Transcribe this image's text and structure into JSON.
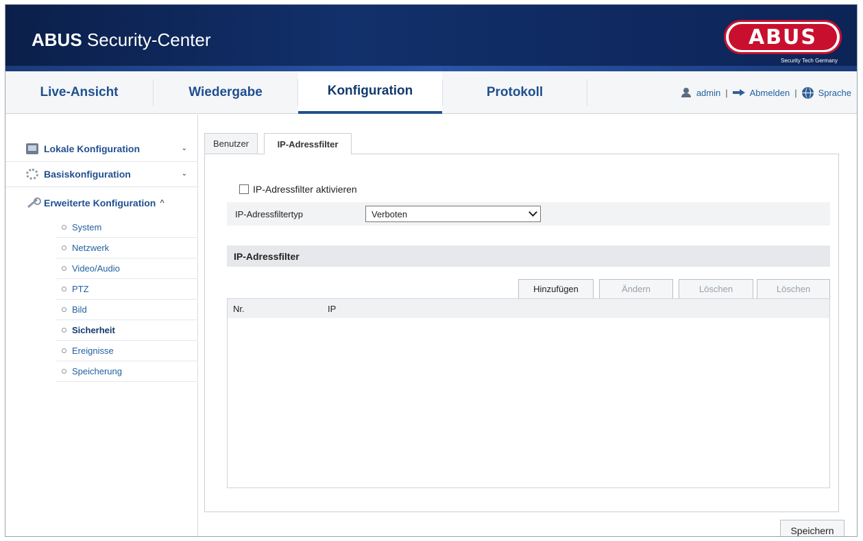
{
  "header": {
    "brand_bold": "ABUS",
    "brand_rest": " Security-Center",
    "logo_text": "ABUS",
    "logo_tagline": "Security Tech Germany"
  },
  "nav": {
    "tabs": [
      "Live-Ansicht",
      "Wiedergabe",
      "Konfiguration",
      "Protokoll"
    ],
    "active_tab": "Konfiguration",
    "user": "admin",
    "logout": "Abmelden",
    "language": "Sprache",
    "separator": "|"
  },
  "sidebar": {
    "groups": [
      {
        "label": "Lokale Konfiguration",
        "icon": "local-config-icon",
        "chevron": "⌄"
      },
      {
        "label": "Basiskonfiguration",
        "icon": "basic-config-icon",
        "chevron": "⌄"
      },
      {
        "label": "Erweiterte Konfiguration",
        "icon": "wrench-icon",
        "chevron": "^"
      }
    ],
    "items": [
      "System",
      "Netzwerk",
      "Video/Audio",
      "PTZ",
      "Bild",
      "Sicherheit",
      "Ereignisse",
      "Speicherung"
    ],
    "active_item": "Sicherheit"
  },
  "content": {
    "tabs": [
      "Benutzer",
      "IP-Adressfilter"
    ],
    "active_tab": "IP-Adressfilter",
    "enable_checkbox_label": "IP-Adressfilter aktivieren",
    "enable_checked": false,
    "filter_type_label": "IP-Adressfiltertyp",
    "filter_type_value": "Verboten",
    "section_title": "IP-Adressfilter",
    "buttons": {
      "add": "Hinzufügen",
      "edit": "Ändern",
      "delete": "Löschen",
      "delete_all": "Löschen"
    },
    "table": {
      "columns": [
        "Nr.",
        "IP"
      ],
      "rows": []
    },
    "save": "Speichern"
  },
  "colors": {
    "header_bg": "#0d2457",
    "nav_text": "#1f4f8f",
    "logo_red": "#c8102e"
  }
}
